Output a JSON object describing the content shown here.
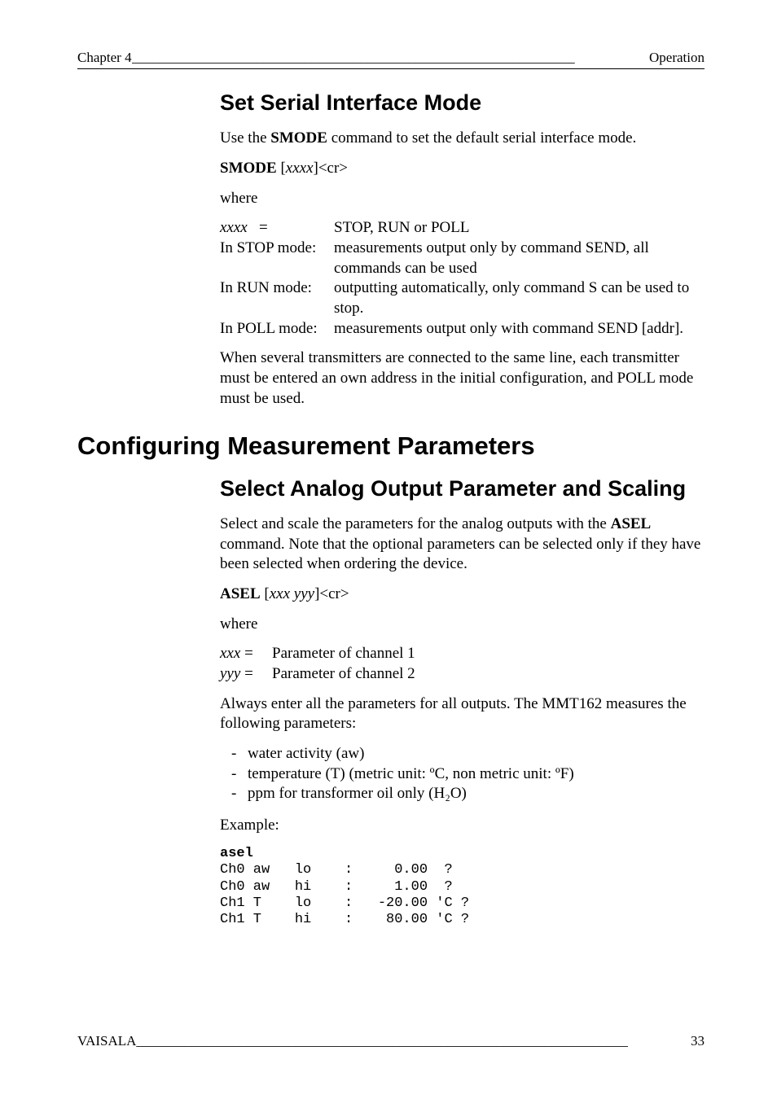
{
  "header": {
    "left": "Chapter 4",
    "fill": " ________________________________________________________________ ",
    "right": "Operation"
  },
  "sec_serial": {
    "title": "Set Serial Interface Mode",
    "intro_pre": "Use the ",
    "intro_bold": "SMODE",
    "intro_post": " command to set the default serial interface mode.",
    "syntax_bold": "SMODE",
    "syntax_arg": " [",
    "syntax_italic": "xxxx",
    "syntax_post": "]<cr>",
    "where": "where",
    "rows": [
      {
        "k_html": "<span class=\"it\">xxxx</span>&nbsp;&nbsp;&nbsp;=",
        "k_plain": "xxxx   =",
        "v": " STOP, RUN or POLL"
      },
      {
        "k_html": "In STOP mode:",
        "v": "measurements output only by command SEND, all commands can be used"
      },
      {
        "k_html": "In RUN mode:",
        "v": "outputting automatically, only command S can be used to stop."
      },
      {
        "k_html": "In POLL mode:",
        "v_html": "measurements output only with command SEND [<span class=\"it\">addr</span>].",
        "v": "measurements output only with command SEND [addr]."
      }
    ],
    "note": "When several transmitters are connected to the same line, each transmitter must be entered an own address in the initial configuration, and POLL mode must be used."
  },
  "sec_config": {
    "title": "Configuring Measurement Parameters",
    "sub": {
      "title": "Select Analog Output Parameter and Scaling",
      "p1_pre": "Select and scale the parameters for the analog outputs with the ",
      "p1_bold": "ASEL",
      "p1_post": " command. Note that the optional parameters can be selected only if they have been selected when ordering the device.",
      "syntax_bold": "ASEL",
      "syntax_arg": " [",
      "syntax_italic": "xxx yyy",
      "syntax_post": "]<cr>",
      "where": "where",
      "vars": [
        {
          "k": "xxx",
          "eq": " =",
          "v": "Parameter of channel 1"
        },
        {
          "k": "yyy",
          "eq": " =",
          "v": "Parameter of channel 2"
        }
      ],
      "p2": "Always enter all the parameters for all outputs. The MMT162 measures the following parameters:",
      "bullets": [
        "water activity (aw)",
        "temperature (T) (metric unit: ºC, non metric unit: ºF)",
        "ppm for transformer oil only (H₂O)"
      ],
      "example_label": "Example:",
      "code": "asel\nCh0 aw   lo    :     0.00  ?\nCh0 aw   hi    :     1.00  ?\nCh1 T    lo    :   -20.00 'C ?\nCh1 T    hi    :    80.00 'C ?",
      "code_first_line_bold": true
    }
  },
  "footer": {
    "left": "VAISALA",
    "fill": " _______________________________________________________________________ ",
    "page": "33"
  }
}
